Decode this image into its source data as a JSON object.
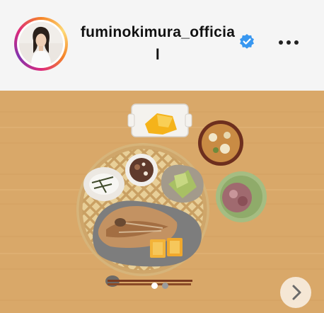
{
  "profile": {
    "username": "fuminokimura_official",
    "verified": true,
    "avatar_icon": "profile-photo",
    "story_ring_colors": [
      "#f58529",
      "#feda77",
      "#dd2a7b",
      "#8134af"
    ]
  },
  "header": {
    "more_icon": "more-horizontal-icon"
  },
  "post": {
    "image_subject": "japanese-breakfast-tray",
    "next_icon": "chevron-right-icon",
    "carousel": {
      "total": 2,
      "active_index": 0
    }
  },
  "colors": {
    "header_bg": "#f5f5f5",
    "verified_blue": "#3897f0",
    "table_wood": "#d9a869",
    "dot_active": "#ffffff",
    "dot_inactive": "#9a9a9a"
  }
}
